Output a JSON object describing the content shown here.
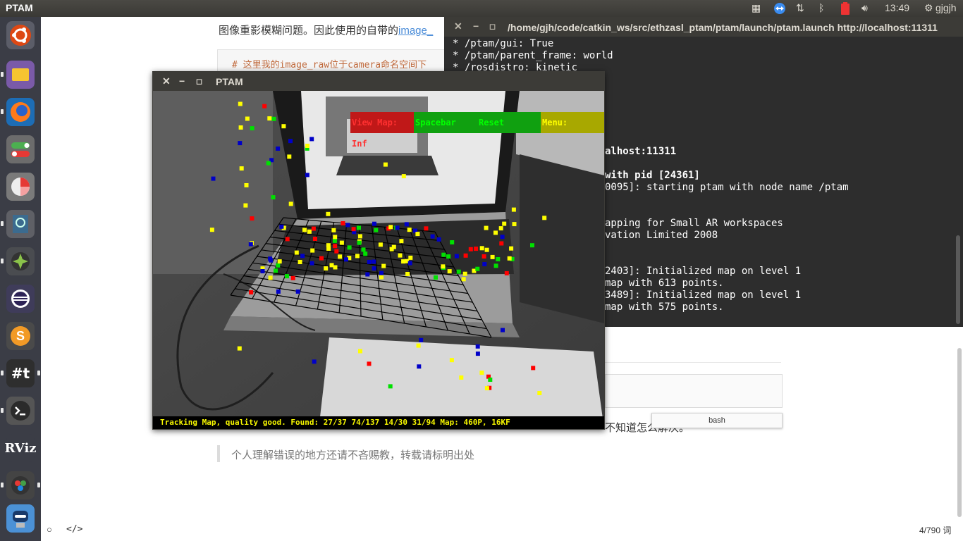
{
  "top_panel": {
    "app_title": "PTAM",
    "time": "13:49",
    "user": "gjgjh",
    "icons": [
      "workspace-icon",
      "teamviewer-icon",
      "network-icon",
      "bluetooth-icon",
      "battery-icon",
      "volume-icon"
    ]
  },
  "launcher": {
    "items": [
      "ubuntu-dash",
      "files",
      "firefox",
      "system-settings",
      "disk-usage",
      "screenshot-tool",
      "system-monitor",
      "eclipse",
      "sublime-text",
      "hashtag-app",
      "terminal",
      "rviz",
      "ros-tool",
      "robot-app"
    ]
  },
  "page": {
    "top_line": "图像重影模糊问题。因此使用的自带的",
    "top_link": "image_",
    "code_line": "# 这里我的image_raw位于camera命名空间下",
    "bottom_line": "不知道怎么解决。",
    "quote": "个人理解错误的地方还请不吝赐教，转载请标明出处",
    "word_count": "4/790 词"
  },
  "terminal": {
    "title": "/home/gjh/code/catkin_ws/src/ethzasl_ptam/ptam/launch/ptam.launch http://localhost:11311",
    "lines": [
      "* /ptam/gui: True",
      "* /ptam/parent_frame: world",
      "* /rosdistro: kinetic",
      "alhost:11311",
      "with pid [24361]",
      "0095]: starting ptam with node name /ptam",
      "apping for Small AR workspaces",
      "vation Limited 2008",
      "2403]: Initialized map on level 1",
      "map with 613 points.",
      "3489]: Initialized map on level 1",
      "map with 575 points."
    ]
  },
  "bash_tooltip": "bash",
  "ptam": {
    "title": "PTAM",
    "menu": {
      "view_map": "View Map: Inf",
      "spacebar": "Spacebar",
      "reset": "Reset",
      "menu": "Menu:"
    },
    "status": "Tracking Map, quality good. Found: 27/37 74/137 14/30 31/94 Map: 460P, 16KF"
  },
  "colors": {
    "point_red": "#ff0000",
    "point_yellow": "#ffff00",
    "point_green": "#00e000",
    "point_blue": "#0000c8"
  }
}
